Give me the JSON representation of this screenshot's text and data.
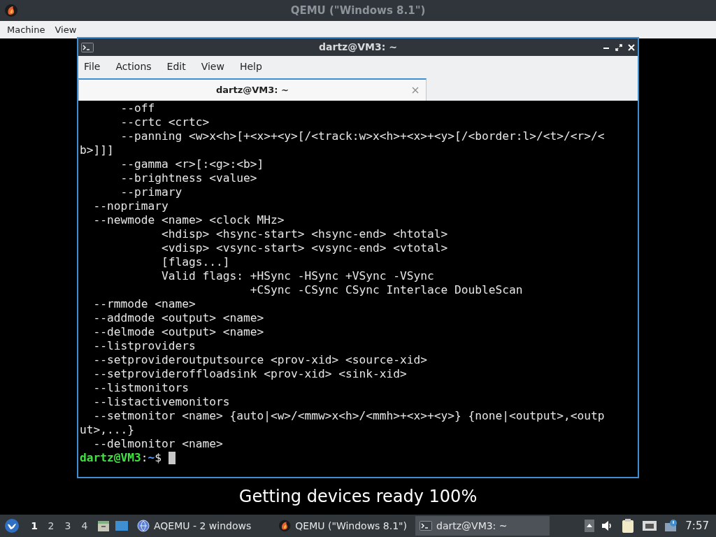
{
  "window": {
    "title": "QEMU (\"Windows 8.1\")",
    "menu": [
      "Machine",
      "View"
    ]
  },
  "terminal": {
    "title": "dartz@VM3: ~",
    "menu": [
      "File",
      "Actions",
      "Edit",
      "View",
      "Help"
    ],
    "tabs": [
      {
        "label": "dartz@VM3: ~",
        "selected": true
      }
    ],
    "lines": [
      "      --off",
      "      --crtc <crtc>",
      "      --panning <w>x<h>[+<x>+<y>[/<track:w>x<h>+<x>+<y>[/<border:l>/<t>/<r>/<",
      "b>]]]",
      "      --gamma <r>[:<g>:<b>]",
      "      --brightness <value>",
      "      --primary",
      "  --noprimary",
      "  --newmode <name> <clock MHz>",
      "            <hdisp> <hsync-start> <hsync-end> <htotal>",
      "            <vdisp> <vsync-start> <vsync-end> <vtotal>",
      "            [flags...]",
      "            Valid flags: +HSync -HSync +VSync -VSync",
      "                         +CSync -CSync CSync Interlace DoubleScan",
      "  --rmmode <name>",
      "  --addmode <output> <name>",
      "  --delmode <output> <name>",
      "  --listproviders",
      "  --setprovideroutputsource <prov-xid> <source-xid>",
      "  --setprovideroffloadsink <prov-xid> <sink-xid>",
      "  --listmonitors",
      "  --listactivemonitors",
      "  --setmonitor <name> {auto|<w>/<mmw>x<h>/<mmh>+<x>+<y>} {none|<output>,<outp",
      "ut>,...}",
      "  --delmonitor <name>"
    ],
    "prompt": {
      "user": "dartz@VM3",
      "separator": ":",
      "path": "~",
      "symbol": "$"
    }
  },
  "status_message": "Getting devices ready 100%",
  "taskbar": {
    "workspaces": [
      {
        "label": "1",
        "selected": true
      },
      {
        "label": "2",
        "selected": false
      },
      {
        "label": "3",
        "selected": false
      },
      {
        "label": "4",
        "selected": false
      }
    ],
    "tasks": [
      {
        "label": "AQEMU - 2 windows",
        "kind": "aqemu",
        "selected": false
      },
      {
        "label": "QEMU (\"Windows 8.1\")",
        "kind": "qemu",
        "selected": false
      },
      {
        "label": "dartz@VM3: ~",
        "kind": "terminal",
        "selected": true
      }
    ],
    "clock": "7:57"
  }
}
